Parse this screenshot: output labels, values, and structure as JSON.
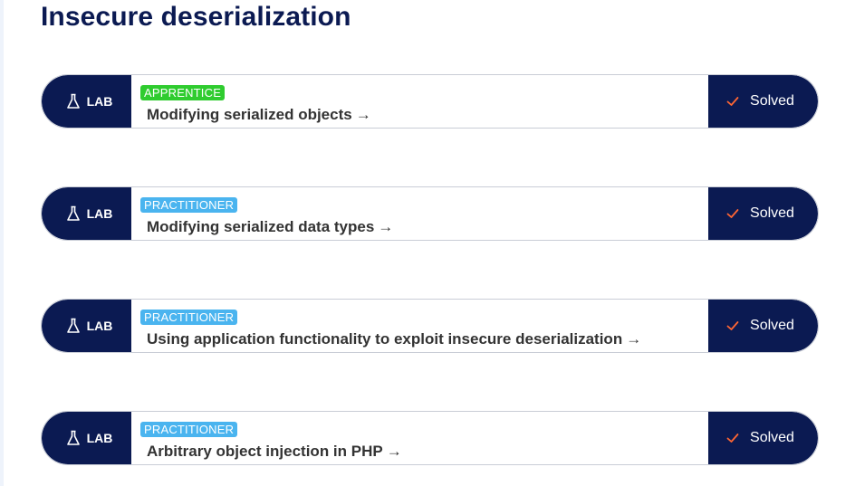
{
  "page": {
    "title": "Insecure deserialization"
  },
  "colors": {
    "navy": "#0b1a52",
    "apprentice": "#2fcc2f",
    "practitioner": "#4ab4ef",
    "check": "#ff6633"
  },
  "labs": [
    {
      "tag": "LAB",
      "level": "APPRENTICE",
      "title": "Modifying serialized objects",
      "arrow": "→",
      "status": "Solved",
      "icon": "flask-icon",
      "status_icon": "check-icon"
    },
    {
      "tag": "LAB",
      "level": "PRACTITIONER",
      "title": "Modifying serialized data types",
      "arrow": "→",
      "status": "Solved",
      "icon": "flask-icon",
      "status_icon": "check-icon"
    },
    {
      "tag": "LAB",
      "level": "PRACTITIONER",
      "title": "Using application functionality to exploit insecure deserialization",
      "arrow": "→",
      "status": "Solved",
      "icon": "flask-icon",
      "status_icon": "check-icon"
    },
    {
      "tag": "LAB",
      "level": "PRACTITIONER",
      "title": "Arbitrary object injection in PHP",
      "arrow": "→",
      "status": "Solved",
      "icon": "flask-icon",
      "status_icon": "check-icon"
    }
  ]
}
